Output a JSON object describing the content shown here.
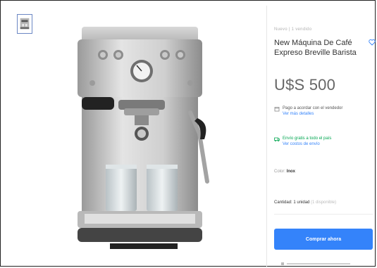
{
  "breadcrumb": "Nuevo | 1 vendido",
  "product": {
    "title": "New Máquina De Café Expreso Breville Barista",
    "price": "U$S 500"
  },
  "shipping": {
    "line1": "Pago a acordar con el vendedor",
    "link1": "Ver más detalles"
  },
  "pickup": {
    "line1": "Envío gratis a todo el país",
    "link1": "Ver costos de envío"
  },
  "color": {
    "label": "Color:",
    "value": "Inox"
  },
  "quantity": {
    "label": "Cantidad: 1 unidad",
    "available": "(1 disponible)"
  },
  "buy_button": "Comprar ahora",
  "colors": {
    "accent": "#3483fa",
    "green": "#00a650",
    "price": "#666666"
  }
}
